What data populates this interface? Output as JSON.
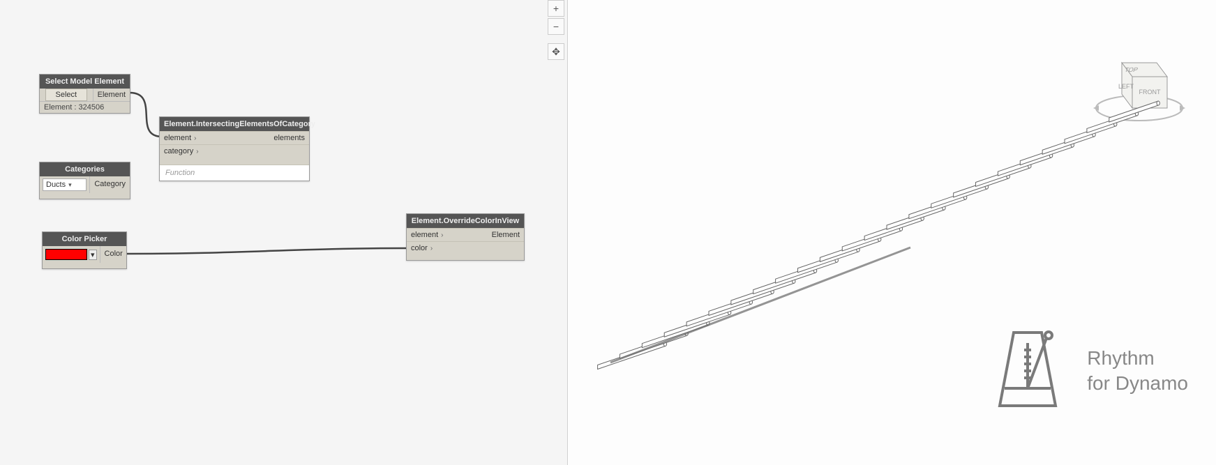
{
  "zoom": {
    "in": "+",
    "out": "−",
    "pan": "✥"
  },
  "nodes": {
    "select_model_element": {
      "title": "Select Model Element",
      "select_btn": "Select",
      "out_port": "Element",
      "status": "Element : 324506"
    },
    "categories": {
      "title": "Categories",
      "selected": "Ducts",
      "out_port": "Category"
    },
    "intersecting": {
      "title": "Element.IntersectingElementsOfCategory",
      "in_ports": [
        "element",
        "category"
      ],
      "out_port": "elements",
      "footer": "Function"
    },
    "color_picker": {
      "title": "Color Picker",
      "out_port": "Color",
      "swatch_color": "#ff0000"
    },
    "override": {
      "title": "Element.OverrideColorInView",
      "in_ports": [
        "element",
        "color"
      ],
      "out_port": "Element"
    }
  },
  "viewcube": {
    "top": "TOP",
    "left": "LEFT",
    "front": "FRONT"
  },
  "logo": {
    "line1": "Rhythm",
    "line2": "for Dynamo"
  }
}
